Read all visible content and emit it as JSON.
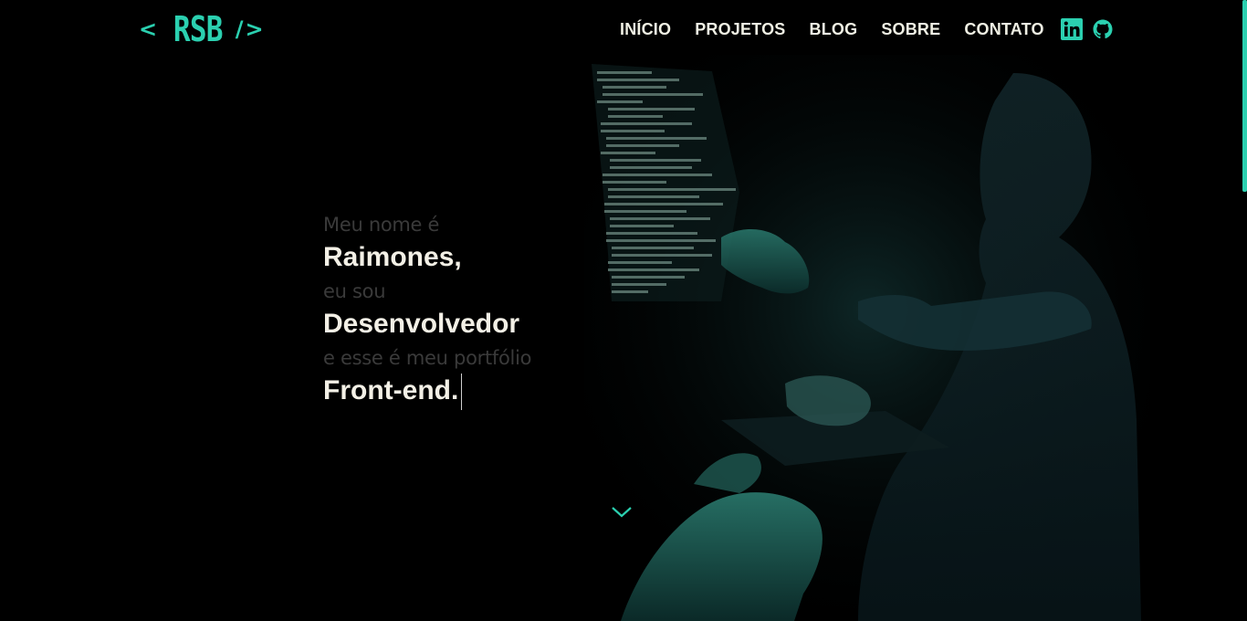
{
  "header": {
    "logo": {
      "open_bracket": "<",
      "mark": "RSB",
      "close_bracket": "/>"
    },
    "nav": [
      {
        "label": "INÍCIO"
      },
      {
        "label": "PROJETOS"
      },
      {
        "label": "BLOG"
      },
      {
        "label": "SOBRE"
      },
      {
        "label": "CONTATO"
      }
    ],
    "social": [
      {
        "icon": "linkedin-icon"
      },
      {
        "icon": "github-icon"
      }
    ]
  },
  "hero": {
    "line1": "Meu nome é",
    "name": "Raimones,",
    "line3": "eu sou",
    "role": "Desenvolvedor",
    "line5": "e esse é meu portfólio",
    "specialty": "Front-end."
  },
  "colors": {
    "accent": "#2bd0b0",
    "background": "#000000",
    "text": "#f3f0e6",
    "muted": "#3a3a3a"
  },
  "icons": {
    "scroll": "chevron-down-icon"
  }
}
